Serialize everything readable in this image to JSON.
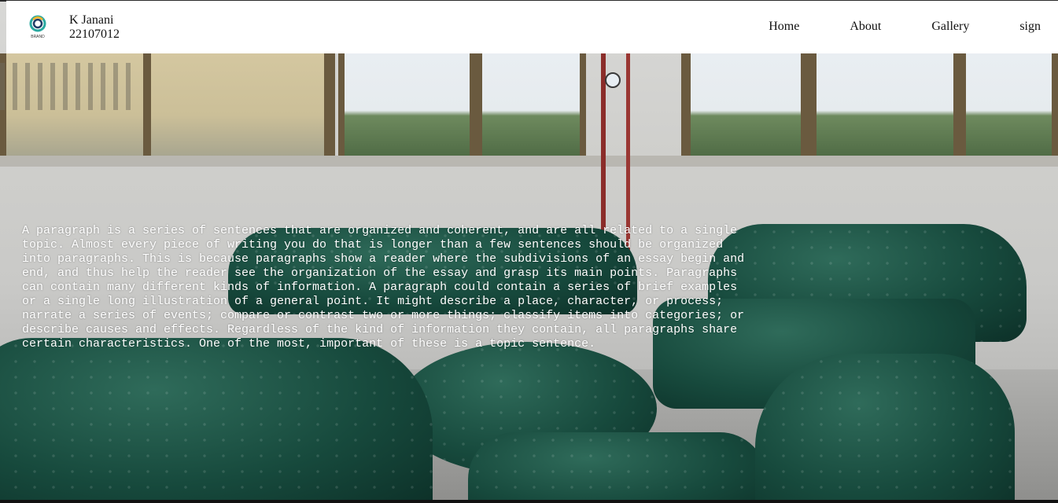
{
  "header": {
    "logo_icon": "brand-logo-icon",
    "logo_text": "BRAND",
    "user_name": "K Janani",
    "user_id": "22107012"
  },
  "nav": {
    "items": [
      {
        "label": "Home"
      },
      {
        "label": "About"
      },
      {
        "label": "Gallery"
      },
      {
        "label": "sign"
      }
    ]
  },
  "main": {
    "paragraph": "A paragraph is a series of sentences that are organized and coherent, and are all related to a single topic. Almost every piece of writing you do that is longer than a few sentences should be organized into paragraphs. This is because paragraphs show a reader where the subdivisions of an essay begin and end, and thus help the reader see the organization of the essay and grasp its main points. Paragraphs can contain many different kinds of information. A paragraph could contain a series of brief examples or a single long illustration of a general point. It might describe a place, character, or process; narrate a series of events; compare or contrast two or more things; classify items into categories; or describe causes and effects. Regardless of the kind of information they contain, all paragraphs share certain characteristics. One of the most, important of these is a topic sentence."
  },
  "background": {
    "image_subject": "green-velvet-chesterfield-sofas-showroom"
  },
  "colors": {
    "navbar_bg": "#ffffff",
    "text_light": "#ffffff",
    "sofa_green": "#174a3d"
  }
}
